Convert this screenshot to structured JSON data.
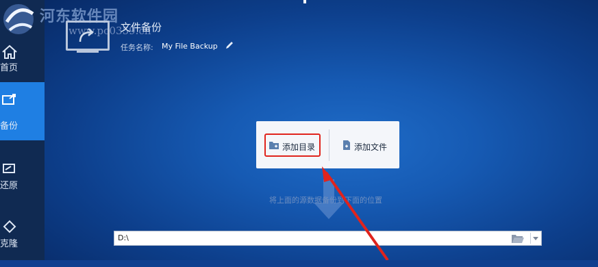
{
  "watermark": {
    "site_name": "河东软件园",
    "url": "www.pc0359.cn"
  },
  "sidebar": {
    "items": [
      {
        "label": "首页",
        "icon": "home-icon"
      },
      {
        "label": "备份",
        "icon": "backup-icon",
        "active": true
      },
      {
        "label": "还原",
        "icon": "restore-icon"
      },
      {
        "label": "克隆",
        "icon": "clone-icon"
      }
    ]
  },
  "task": {
    "title": "文件备份",
    "name_label": "任务名称:",
    "name_value": "My File Backup",
    "icon": "backup-monitor-icon",
    "edit_icon": "pencil-icon"
  },
  "source": {
    "add_directory_label": "添加目录",
    "add_file_label": "添加文件",
    "hint": "将上面的源数据备份到下面的位置"
  },
  "destination": {
    "value": "D:\\"
  },
  "colors": {
    "active_tab": "#1f7fe3",
    "highlight": "#e0231c",
    "background": "#165ab3"
  }
}
